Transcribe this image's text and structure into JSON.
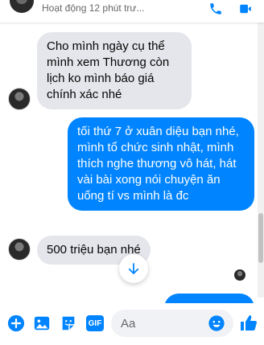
{
  "header": {
    "status": "Hoạt động 12 phút trư...",
    "icons": [
      "avatar",
      "phone-icon",
      "video-icon"
    ]
  },
  "messages": [
    {
      "direction": "incoming",
      "text": "Cho mình ngày cụ thể mình xem Thương còn lịch ko mình báo giá chính xác nhé"
    },
    {
      "direction": "outgoing",
      "text": "tối thứ 7 ở xuân diệu bạn nhé, mình tổ chức sinh nhật, mình thích nghe thương vô hát, hát vài bài xong nói chuyện ăn uống tí vs mình là đc"
    },
    {
      "direction": "incoming",
      "text": "500 triệu bạn nhé"
    }
  ],
  "composer": {
    "placeholder": "Aa",
    "gif_label": "GIF",
    "icons": [
      "add-icon",
      "image-icon",
      "sticker-icon",
      "gif-icon",
      "emoji-icon",
      "like-icon"
    ]
  },
  "colors": {
    "accent": "#0084ff",
    "incoming_bubble": "#e4e6eb",
    "outgoing_bubble": "#0084ff"
  }
}
